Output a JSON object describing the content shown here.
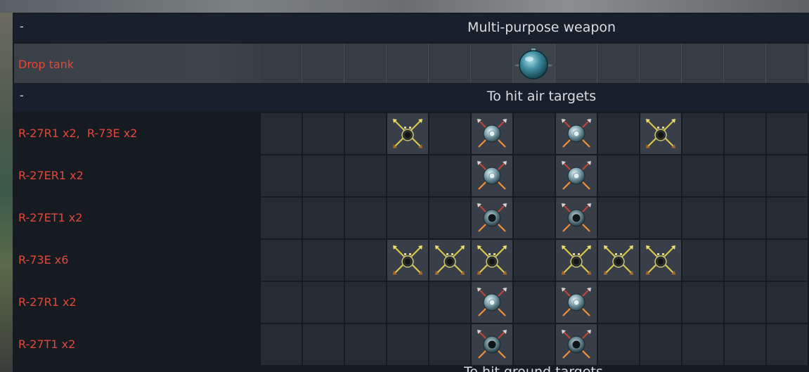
{
  "sections": {
    "multipurpose": {
      "dash": "-",
      "title": "Multi-purpose weapon"
    },
    "air": {
      "dash": "-",
      "title": "To hit air targets"
    },
    "ground_partial": "To hit ground targets"
  },
  "drop_row": {
    "label": "Drop tank",
    "filled_slot": 6,
    "icon": "drop-tank-icon"
  },
  "rows": [
    {
      "label": "R-27R1 x2,  R-73E x2",
      "slots": [
        null,
        null,
        null,
        "r73",
        null,
        "r27",
        null,
        "r27",
        null,
        "r73",
        null,
        null,
        null
      ]
    },
    {
      "label": "R-27ER1 x2",
      "slots": [
        null,
        null,
        null,
        null,
        null,
        "r27",
        null,
        "r27",
        null,
        null,
        null,
        null,
        null
      ]
    },
    {
      "label": "R-27ET1 x2",
      "slots": [
        null,
        null,
        null,
        null,
        null,
        "r27t",
        null,
        "r27t",
        null,
        null,
        null,
        null,
        null
      ]
    },
    {
      "label": "R-73E x6",
      "slots": [
        null,
        null,
        null,
        "r73",
        "r73",
        "r73",
        null,
        "r73",
        "r73",
        "r73",
        null,
        null,
        null
      ]
    },
    {
      "label": "R-27R1 x2",
      "slots": [
        null,
        null,
        null,
        null,
        null,
        "r27",
        null,
        "r27",
        null,
        null,
        null,
        null,
        null
      ]
    },
    {
      "label": "R-27T1 x2",
      "slots": [
        null,
        null,
        null,
        null,
        null,
        "r27t",
        null,
        "r27t",
        null,
        null,
        null,
        null,
        null
      ]
    }
  ],
  "icon_names": {
    "r27": "r27-missile-icon",
    "r27t": "r27-ir-missile-icon",
    "r73": "r73-missile-icon"
  },
  "colors": {
    "label": "#e2483a",
    "header_text": "#d9dde1"
  }
}
